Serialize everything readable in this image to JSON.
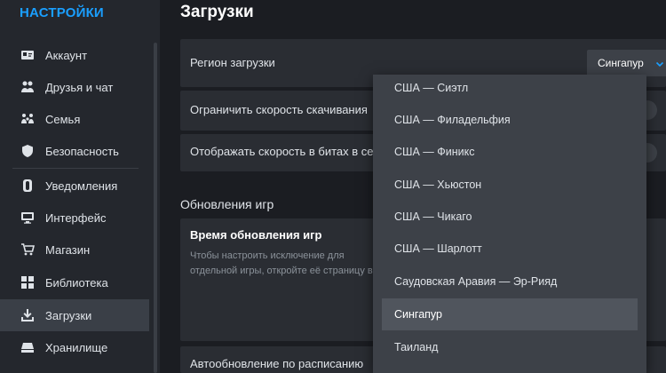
{
  "sidebar": {
    "title": "НАСТРОЙКИ",
    "items": [
      {
        "label": "Аккаунт",
        "icon": "account-card-icon"
      },
      {
        "label": "Друзья и чат",
        "icon": "friends-icon"
      },
      {
        "label": "Семья",
        "icon": "family-icon"
      },
      {
        "label": "Безопасность",
        "icon": "shield-icon"
      },
      {
        "label": "Уведомления",
        "icon": "notifications-icon"
      },
      {
        "label": "Интерфейс",
        "icon": "monitor-icon"
      },
      {
        "label": "Магазин",
        "icon": "cart-icon"
      },
      {
        "label": "Библиотека",
        "icon": "library-grid-icon"
      },
      {
        "label": "Загрузки",
        "icon": "download-icon"
      },
      {
        "label": "Хранилище",
        "icon": "storage-drive-icon"
      }
    ],
    "active_index": 8
  },
  "main": {
    "title": "Загрузки",
    "region_label": "Регион загрузки",
    "region_value": "Сингапур",
    "limit_speed_label": "Ограничить скорость скачивания",
    "bits_speed_label": "Отображать скорость в битах в секунду",
    "game_updates_heading": "Обновления игр",
    "update_time_title": "Время обновления игр",
    "update_time_desc": "Чтобы настроить исключение для отдельной игры, откройте её страницу в библиотеке, нажмите на иконку",
    "scheduled_update_label": "Автообновление по расписанию"
  },
  "dropdown": {
    "options": [
      "США — Сиэтл",
      "США — Филадельфия",
      "США — Финикс",
      "США — Хьюстон",
      "США — Чикаго",
      "США — Шарлотт",
      "Саудовская Аравия — Эр-Рияд",
      "Сингапур",
      "Таиланд"
    ],
    "selected": "Сингапур"
  },
  "colors": {
    "accent": "#1a9fff",
    "background": "#1b1d22",
    "sidebar": "#24272d",
    "panel": "#2a2d33",
    "dropdown": "#3d4148"
  }
}
